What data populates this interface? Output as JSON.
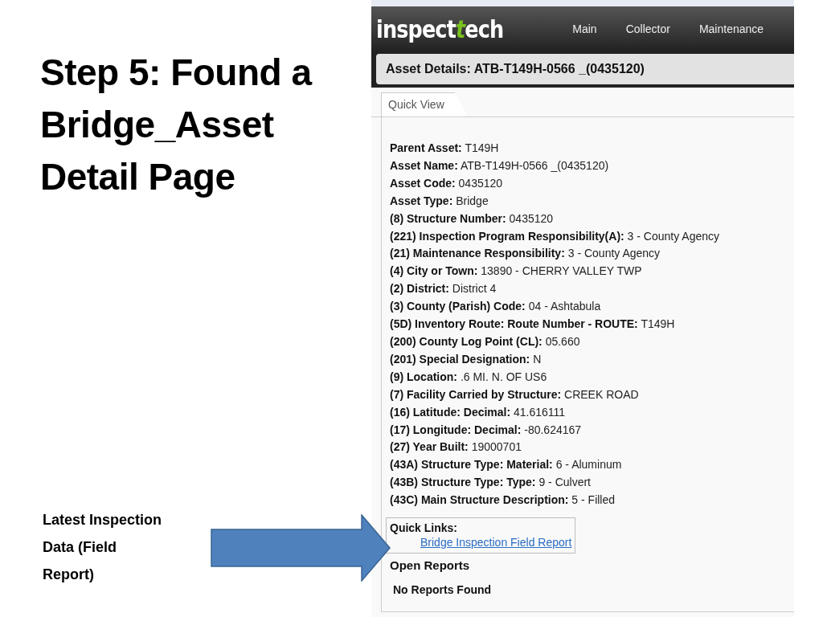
{
  "slide": {
    "title_lines": [
      "Step 5: Found a",
      "Bridge_Asset",
      "Detail Page"
    ],
    "callout_lines": [
      "Latest Inspection",
      "Data (Field",
      "Report)"
    ]
  },
  "app": {
    "logo": [
      {
        "text": "inspect",
        "accent": false
      },
      {
        "text": "t",
        "accent": true
      },
      {
        "text": "ech",
        "accent": false
      }
    ],
    "nav": [
      {
        "label": "Main",
        "selected": false
      },
      {
        "label": "Collector",
        "selected": false
      },
      {
        "label": "Maintenance",
        "selected": false
      }
    ],
    "page_title": "Asset Details: ATB-T149H-0566 _(0435120)",
    "tabs": [
      {
        "label": "Quick View",
        "selected": true
      }
    ],
    "fields": [
      {
        "label": "Parent Asset:",
        "value": "T149H"
      },
      {
        "label": "Asset Name:",
        "value": "ATB-T149H-0566 _(0435120)"
      },
      {
        "label": "Asset Code:",
        "value": "0435120"
      },
      {
        "label": "Asset Type:",
        "value": "Bridge"
      },
      {
        "label": "(8) Structure Number:",
        "value": "0435120"
      },
      {
        "label": "(221) Inspection Program Responsibility(A):",
        "value": "3 - County Agency"
      },
      {
        "label": "(21) Maintenance Responsibility:",
        "value": "3 - County Agency"
      },
      {
        "label": "(4) City or Town:",
        "value": "13890 - CHERRY VALLEY TWP"
      },
      {
        "label": "(2) District:",
        "value": "District 4"
      },
      {
        "label": "(3) County (Parish) Code:",
        "value": "04 - Ashtabula"
      },
      {
        "label": "(5D) Inventory Route: Route Number - ROUTE:",
        "value": "T149H"
      },
      {
        "label": "(200) County Log Point (CL):",
        "value": "05.660"
      },
      {
        "label": "(201) Special Designation:",
        "value": "N"
      },
      {
        "label": "(9) Location:",
        "value": ".6 MI. N. OF US6"
      },
      {
        "label": "(7) Facility Carried by Structure:",
        "value": "CREEK ROAD"
      },
      {
        "label": "(16) Latitude: Decimal:",
        "value": "41.616111"
      },
      {
        "label": "(17) Longitude: Decimal:",
        "value": "-80.624167"
      },
      {
        "label": "(27) Year Built:",
        "value": "19000701"
      },
      {
        "label": "(43A) Structure Type: Material:",
        "value": "6 - Aluminum"
      },
      {
        "label": "(43B) Structure Type: Type:",
        "value": "9 - Culvert"
      },
      {
        "label": "(43C) Main Structure Description:",
        "value": "5 - Filled"
      }
    ],
    "quick_links": {
      "heading": "Quick Links:",
      "links": [
        "Bridge Inspection Field Report"
      ]
    },
    "open_reports": {
      "heading": "Open Reports",
      "empty_text": "No Reports Found"
    }
  }
}
